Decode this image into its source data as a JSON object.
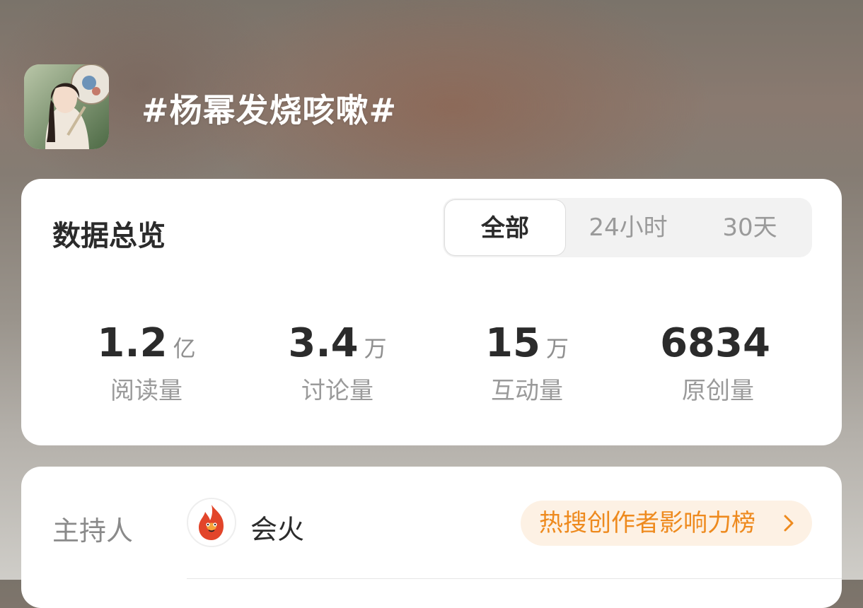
{
  "header": {
    "topic_title": "#杨幂发烧咳嗽#"
  },
  "overview": {
    "title": "数据总览",
    "tabs": [
      {
        "label": "全部",
        "active": true
      },
      {
        "label": "24小时",
        "active": false
      },
      {
        "label": "30天",
        "active": false
      }
    ],
    "stats": [
      {
        "value": "1.2",
        "unit": "亿",
        "label": "阅读量"
      },
      {
        "value": "3.4",
        "unit": "万",
        "label": "讨论量"
      },
      {
        "value": "15",
        "unit": "万",
        "label": "互动量"
      },
      {
        "value": "6834",
        "unit": "",
        "label": "原创量"
      }
    ]
  },
  "host": {
    "label": "主持人",
    "name": "会火",
    "rank_link": "热搜创作者影响力榜"
  },
  "colors": {
    "accent_orange": "#ee8a1e",
    "pill_bg": "#fdf1e4",
    "text_primary": "#2b2b2b",
    "text_secondary": "#9a9a9a"
  }
}
